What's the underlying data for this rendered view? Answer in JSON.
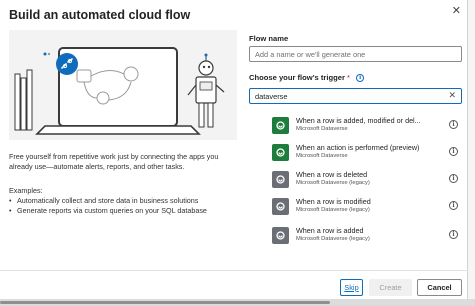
{
  "dialog": {
    "title": "Build an automated cloud flow",
    "close_glyph": "✕"
  },
  "left": {
    "description": "Free yourself from repetitive work just by connecting the apps you already use—automate alerts, reports, and other tasks.",
    "examples_title": "Examples:",
    "examples": [
      "Automatically collect and store data in business solutions",
      "Generate reports via custom queries on your SQL database"
    ]
  },
  "flow_name": {
    "label": "Flow name",
    "placeholder": "Add a name or we'll generate one"
  },
  "trigger": {
    "label": "Choose your flow's trigger",
    "required_mark": "*",
    "search_value": "dataverse",
    "clear_glyph": "✕"
  },
  "triggers": [
    {
      "name": "When a row is added, modified or del...",
      "connector": "Microsoft Dataverse",
      "color": "#1e7d3c",
      "icon": "dataverse-icon"
    },
    {
      "name": "When an action is performed (preview)",
      "connector": "Microsoft Dataverse",
      "color": "#1e7d3c",
      "icon": "dataverse-icon"
    },
    {
      "name": "When a row is deleted",
      "connector": "Microsoft Dataverse (legacy)",
      "color": "#6b6f75",
      "icon": "dataverse-legacy-icon"
    },
    {
      "name": "When a row is modified",
      "connector": "Microsoft Dataverse (legacy)",
      "color": "#6b6f75",
      "icon": "dataverse-legacy-icon"
    },
    {
      "name": "When a row is added",
      "connector": "Microsoft Dataverse (legacy)",
      "color": "#6b6f75",
      "icon": "dataverse-legacy-icon"
    }
  ],
  "footer": {
    "skip_label": "Skip",
    "create_label": "Create",
    "cancel_label": "Cancel"
  },
  "colors": {
    "accent": "#0f6cbd",
    "dataverse_green": "#1e7d3c",
    "legacy_gray": "#6b6f75"
  }
}
